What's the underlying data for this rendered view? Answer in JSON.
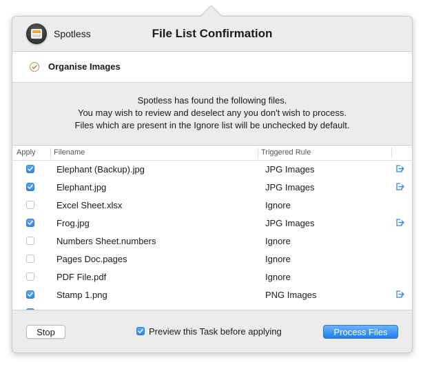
{
  "window": {
    "app_name": "Spotless",
    "title": "File List Confirmation"
  },
  "task": {
    "label": "Organise Images",
    "icon": "task-complete-check-icon"
  },
  "message": {
    "line1": "Spotless has found the following files.",
    "line2": "You may wish to review and deselect any you don't wish to process.",
    "line3": "Files which are present in the Ignore list will be unchecked by default."
  },
  "table": {
    "columns": [
      "Apply",
      "Filename",
      "Triggered Rule"
    ],
    "rows": [
      {
        "apply": true,
        "filename": "Elephant (Backup).jpg",
        "rule": "JPG Images",
        "reveal": true
      },
      {
        "apply": true,
        "filename": "Elephant.jpg",
        "rule": "JPG Images",
        "reveal": true
      },
      {
        "apply": false,
        "filename": "Excel Sheet.xlsx",
        "rule": "Ignore",
        "reveal": false
      },
      {
        "apply": true,
        "filename": "Frog.jpg",
        "rule": "JPG Images",
        "reveal": true
      },
      {
        "apply": false,
        "filename": "Numbers Sheet.numbers",
        "rule": "Ignore",
        "reveal": false
      },
      {
        "apply": false,
        "filename": "Pages Doc.pages",
        "rule": "Ignore",
        "reveal": false
      },
      {
        "apply": false,
        "filename": "PDF File.pdf",
        "rule": "Ignore",
        "reveal": false
      },
      {
        "apply": true,
        "filename": "Stamp 1.png",
        "rule": "PNG Images",
        "reveal": true
      }
    ]
  },
  "footer": {
    "stop_label": "Stop",
    "preview_label": "Preview this Task before applying",
    "preview_checked": true,
    "process_label": "Process Files"
  },
  "colors": {
    "accent": "#2f86f0",
    "background": "#ececec"
  }
}
